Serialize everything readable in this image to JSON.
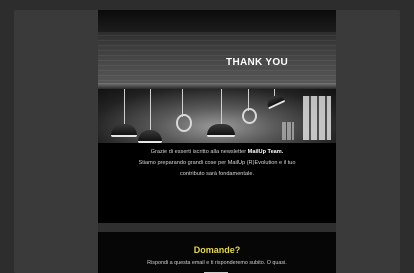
{
  "hero": {
    "title": "THANK YOU"
  },
  "message": {
    "line1_pre": "Grazie di esserti iscritto alla newsletter ",
    "line1_brand": "MailUp Team.",
    "line2": "Stiamo preparando grandi cose per MailUp (R)Evolution e il tuo",
    "line3": "contributo sarà fondamentale."
  },
  "faq": {
    "title": "Domande?",
    "text": "Rispondi a questa email e ti risponderemo subito. O quasi."
  },
  "colors": {
    "background": "#2d2d2d",
    "email_background": "#000000",
    "accent": "#e3d94a"
  }
}
